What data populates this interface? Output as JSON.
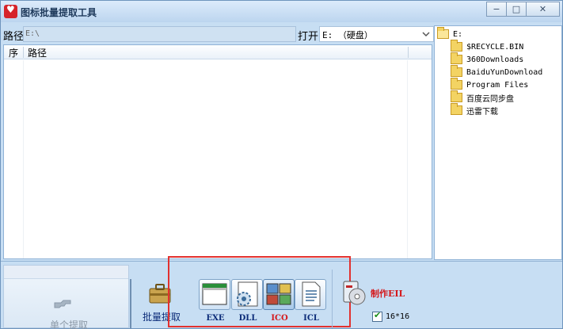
{
  "window": {
    "title": "图标批量提取工具",
    "controls": {
      "minimize": "−",
      "maximize": "□",
      "close": "✕"
    }
  },
  "path_bar": {
    "label": "路径",
    "value": "E:\\",
    "open_label": "打开",
    "drive_value": "E: （硬盘）"
  },
  "list": {
    "columns": [
      "序",
      "路径"
    ]
  },
  "tree": {
    "root": "E:",
    "items": [
      "$RECYCLE.BIN",
      "360Downloads",
      "BaiduYunDownload",
      "Program Files",
      "百度云同步盘",
      "迅雷下载"
    ]
  },
  "toolbar": {
    "single_label": "单个提取",
    "batch_label": "批量提取",
    "types": [
      {
        "label": "EXE",
        "icon": "window-icon"
      },
      {
        "label": "DLL",
        "icon": "gear-file-icon"
      },
      {
        "label": "ICO",
        "icon": "image-grid-icon"
      },
      {
        "label": "ICL",
        "icon": "document-icon"
      }
    ],
    "make_label": "制作EIL",
    "size_label": "16*16",
    "size_checked": true
  }
}
